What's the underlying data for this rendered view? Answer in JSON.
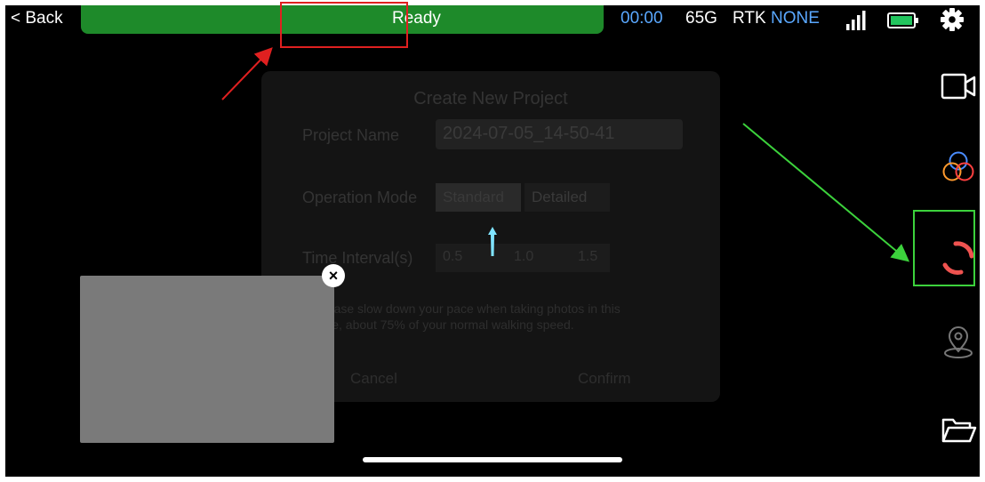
{
  "header": {
    "back_label": "< Back",
    "status": "Ready",
    "timer": "00:00",
    "storage": "65G",
    "rtk_label": "RTK",
    "rtk_value": "NONE",
    "colors": {
      "status_bar": "#1e8a2a",
      "accent": "#5aa8ff",
      "battery": "#22c55e"
    }
  },
  "toolbar": {
    "items": [
      "video-camera-icon",
      "color-filter-icon",
      "capture-mode-icon",
      "location-pin-icon",
      "folder-icon"
    ],
    "capture_colors": [
      "#ef5350",
      "#ef5350"
    ]
  },
  "dialog": {
    "title": "Create New Project",
    "project_name_label": "Project Name",
    "project_name_value": "2024-07-05_14-50-41",
    "operation_mode_label": "Operation Mode",
    "mode_options": [
      "Standard",
      "Detailed"
    ],
    "time_interval_label": "Time Interval(s)",
    "interval_options": [
      "0.5",
      "1.0",
      "1.5"
    ],
    "note_line1": "* Please slow down your pace when taking photos in this",
    "note_line2": "mode, about 75% of your normal walking speed.",
    "cancel_label": "Cancel",
    "confirm_label": "Confirm"
  },
  "preview": {
    "close_symbol": "×"
  },
  "annotations": {
    "box_red": "#e02020",
    "box_green": "#3cd23c"
  }
}
